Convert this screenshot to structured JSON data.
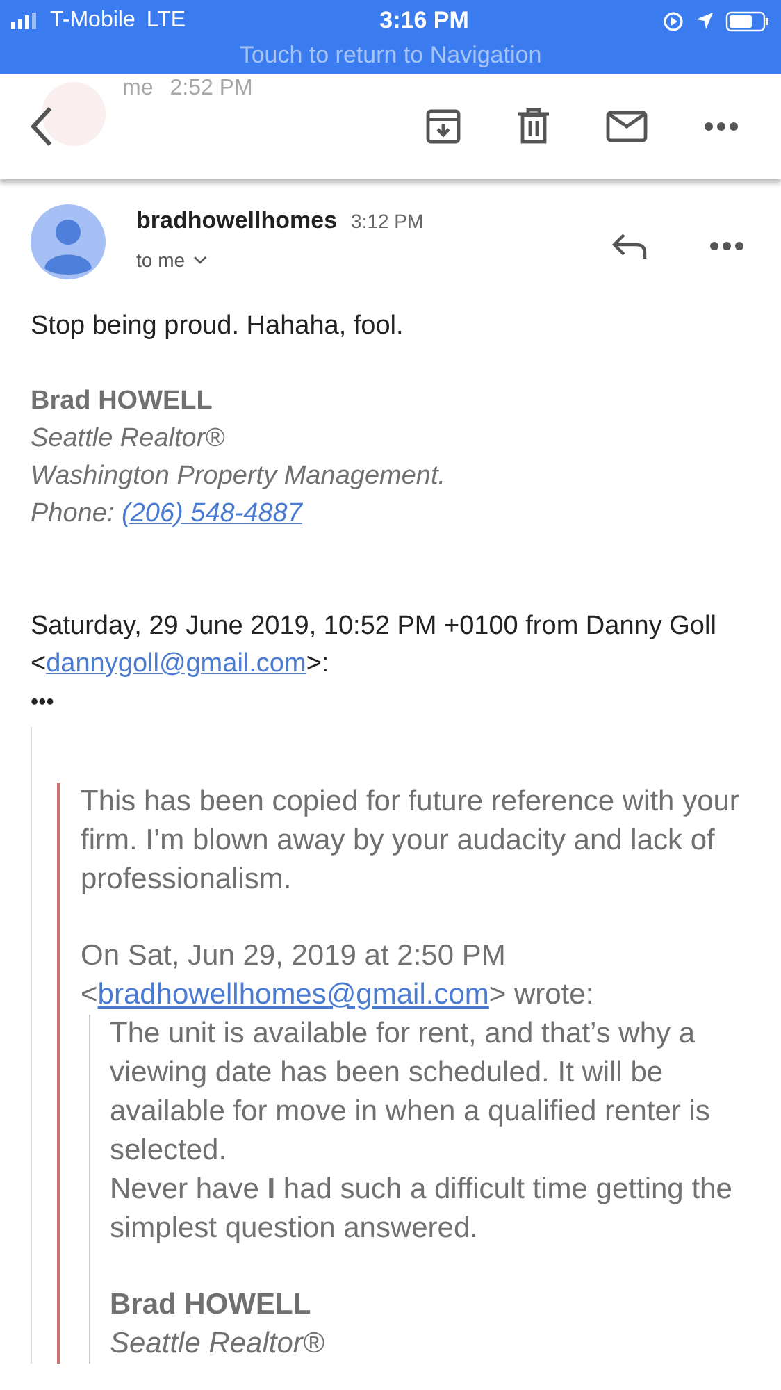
{
  "status_bar": {
    "carrier": "T-Mobile",
    "network": "LTE",
    "time": "3:16 PM",
    "banner": "Touch to return to Navigation"
  },
  "collapsed_header": {
    "sender": "me",
    "time": "2:52 PM"
  },
  "message": {
    "sender": "bradhowellhomes",
    "time": "3:12 PM",
    "recipient": "to me",
    "body": "Stop being proud. Hahaha, fool.",
    "signature": {
      "name": "Brad HOWELL",
      "title": "Seattle Realtor®",
      "company": "Washington Property Management.",
      "phone_label": "Phone:",
      "phone": "(206) 548-4887"
    },
    "quote_header": "Saturday, 29 June 2019, 10:52 PM +0100 from Danny Goll <",
    "quote_email": "dannygoll@gmail.com",
    "quote_header_end": ">:",
    "expand": "•••",
    "quoted": {
      "body": "This has been copied for future reference with your firm. I’m blown away by your audacity and lack of professionalism.",
      "attribution": "On Sat, Jun 29, 2019 at 2:50 PM",
      "attribution_pre": "<",
      "attribution_email": "bradhowellhomes@gmail.com",
      "attribution_post": "> wrote:",
      "nested": {
        "paragraphs": [
          "The unit is available for rent, and that’s why a viewing date has been scheduled. It will be available for move in when a qualified renter is selected.",
          "Never have **I** had such a difficult time getting the simplest question answered."
        ],
        "signature_name": "Brad HOWELL",
        "signature_title": "Seattle Realtor®"
      }
    }
  }
}
